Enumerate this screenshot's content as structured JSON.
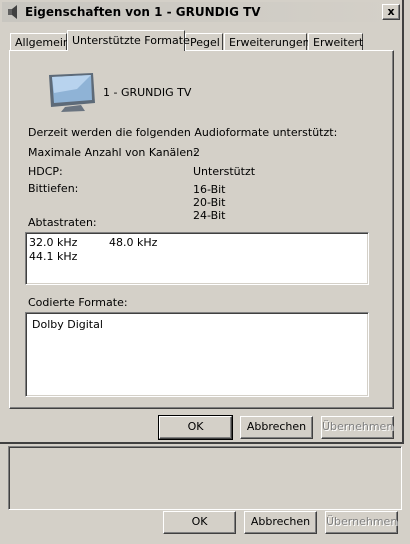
{
  "window": {
    "title": "Eigenschaften von 1 - GRUNDIG TV",
    "close_label": "x"
  },
  "tabs": [
    {
      "label": "Allgemein"
    },
    {
      "label": "Unterstützte Formate"
    },
    {
      "label": "Pegel"
    },
    {
      "label": "Erweiterungen"
    },
    {
      "label": "Erweitert"
    }
  ],
  "device": {
    "name": "1 - GRUNDIG TV",
    "icon": "tv-monitor-icon"
  },
  "formats": {
    "intro": "Derzeit werden die folgenden Audioformate unterstützt:",
    "max_channels_label": "Maximale Anzahl von Kanälen:",
    "max_channels_value": "2",
    "hdcp_label": "HDCP:",
    "hdcp_value": "Unterstützt",
    "bitdepth_label": "Bittiefen:",
    "bitdepths": [
      "16-Bit",
      "20-Bit",
      "24-Bit"
    ],
    "samplerates_label": "Abtastraten:",
    "samplerates": [
      "32.0 kHz",
      "48.0 kHz",
      "44.1 kHz"
    ],
    "encoded_label": "Codierte Formate:",
    "encoded": [
      "Dolby Digital"
    ]
  },
  "buttons": {
    "ok": "OK",
    "cancel": "Abbrechen",
    "apply": "Übernehmen"
  },
  "parent_buttons": {
    "ok": "OK",
    "cancel": "Abbrechen",
    "apply": "Übernehmen"
  }
}
